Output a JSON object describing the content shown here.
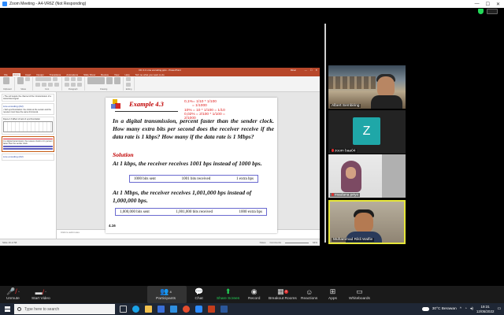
{
  "window": {
    "title": "Zoom Meeting - A4-VR6Z (Not Responding)",
    "controls": [
      "—",
      "☐",
      "✕"
    ]
  },
  "powerpoint": {
    "title": "DC 4.1 Line encoding.pptx - PowerPoint",
    "user": "Dinar",
    "tabs": [
      "File",
      "Home",
      "Insert",
      "Design",
      "Transitions",
      "Animations",
      "Slide Show",
      "Review",
      "View",
      "Help",
      "Tell me what you want to do"
    ],
    "active_tab": "Home",
    "ribbon_groups": [
      "Clipboard",
      "Slides",
      "Font",
      "Paragraph",
      "Drawing",
      "Editing"
    ],
    "thumbnails": [
      {
        "title": "",
        "text": "• The cell require the channel of the ti transmission of a transmitted signal"
      },
      {
        "title": "Line encoding (2/2)",
        "text": "• Self-synchronization: the clocks at the sender and the receiver must have the same bit interval."
      },
      {
        "title": "Figure 4.3 Effect of lack of synchronization",
        "text": ""
      },
      {
        "title": "Example 4.3",
        "text": "In a digital transmission, the receiver clock is 0.1 percent faster than the sender clock."
      },
      {
        "title": "Line encoding (2/2)",
        "text": ""
      }
    ],
    "notes_placeholder": "Click to add notes",
    "status_left": "Slide 16 of 58",
    "status_right": [
      "Notes",
      "Comments",
      "64%"
    ]
  },
  "slide": {
    "title": "Example 4.3",
    "annotations": [
      "0,1%= 1/10 * 1/100",
      "= 1/1000",
      "10% = 10 * 1/100 = 1/10",
      "0,02% = 2/100 * 1/100 =",
      "2/1000"
    ],
    "question": "In a digital transmission, the receiver clock is 0.1 percent faster than the sender clock. How many extra bits per second does the receiver receive if the data rate is 1 kbps? How many if the data rate is 1 Mbps?",
    "question_visible": "In a digital transmission, percent faster than the sender clock. How many extra bits per second does the receiver receive if the data rate is 1 kbps? How many if the data rate is 1 Mbps?",
    "solution_label": "Solution",
    "para1": "At 1 kbps, the receiver receives 1001 bps instead of 1000 bps.",
    "table1": [
      "1000 bits sent",
      "1001 bits received",
      "1 extra bps"
    ],
    "para2": "At 1 Mbps, the receiver receives 1,001,000 bps instead of 1,000,000 bps.",
    "table2": [
      "1,000,000 bits sent",
      "1,001,000 bits received",
      "1000 extra bps"
    ],
    "number": "4.16"
  },
  "participants_gallery": [
    {
      "name": "Albert Sembiring",
      "muted": false
    },
    {
      "name": "zoom baa04",
      "initial": "Z",
      "muted": true
    },
    {
      "name": "maulana priyo",
      "muted": true
    },
    {
      "name": "Muhammad Rikli Walfie",
      "muted": false,
      "active_speaker": true
    }
  ],
  "toolbar": {
    "unmute": "Unmute",
    "start_video": "Start Video",
    "participants": "Participants",
    "participants_count": "4",
    "chat": "Chat",
    "share_screen": "Share Screen",
    "record": "Record",
    "breakout_rooms": "Breakout Rooms",
    "reactions": "Reactions",
    "apps": "Apps",
    "whiteboards": "Whiteboards"
  },
  "taskbar": {
    "search_placeholder": "Type here to search",
    "weather": "30°C Berawan",
    "time": "19:31",
    "date": "12/05/2022"
  },
  "colors": {
    "zoom_green": "#23d959",
    "ppt_red": "#b7472a",
    "slide_red": "#c00000",
    "avatar_teal": "#1fa7a8",
    "speaker_border": "#e6e63a"
  }
}
